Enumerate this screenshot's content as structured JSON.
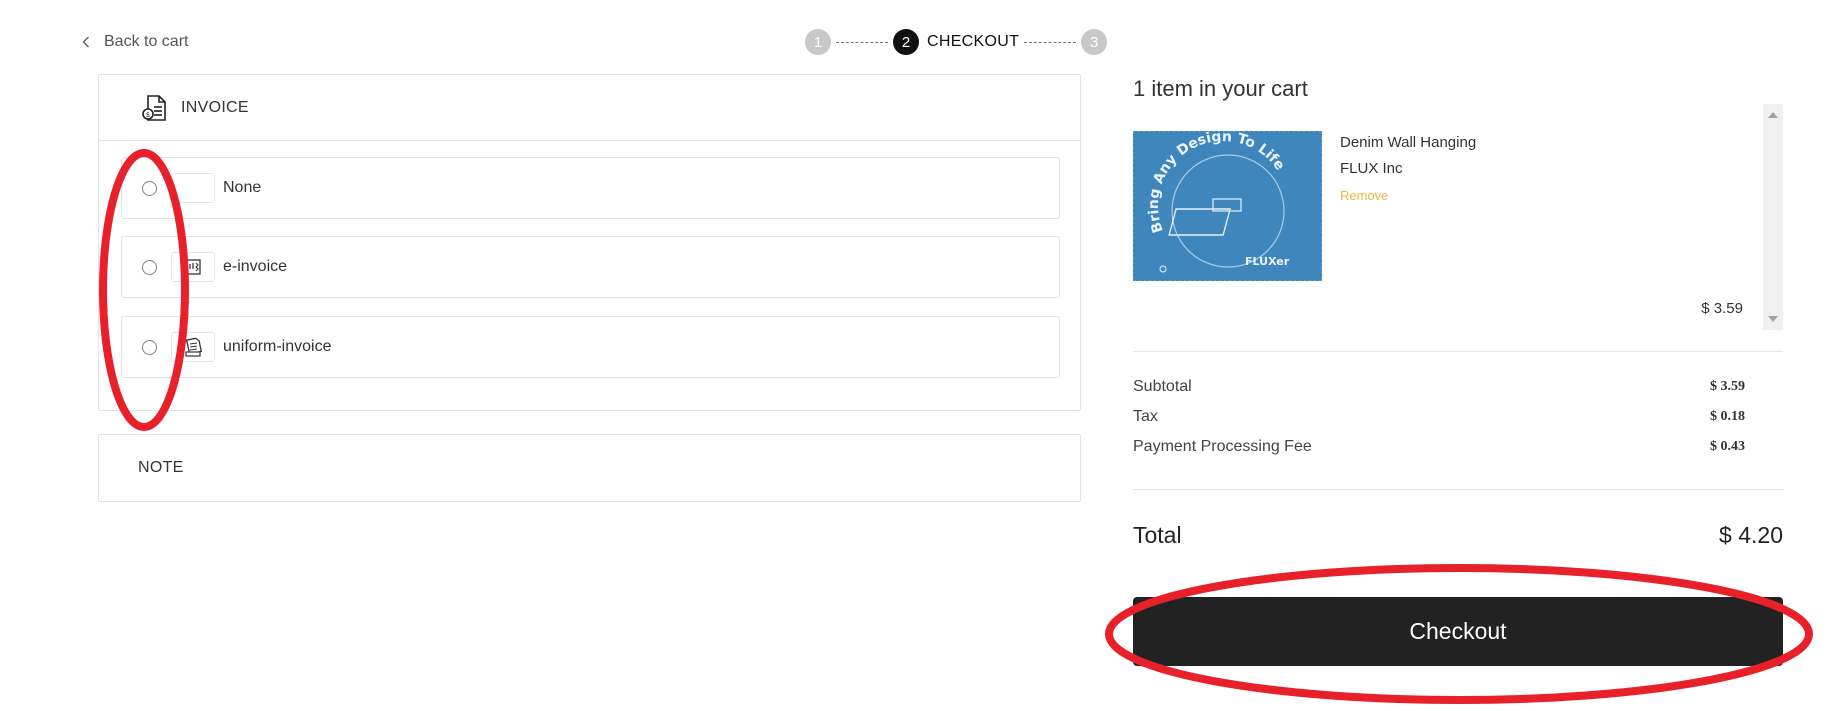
{
  "nav": {
    "back_label": "Back to cart"
  },
  "stepper": {
    "steps": [
      {
        "number": "1"
      },
      {
        "number": "2",
        "label": "CHECKOUT"
      },
      {
        "number": "3"
      }
    ]
  },
  "invoice": {
    "title": "INVOICE",
    "options": [
      {
        "label": "None",
        "icon": "blank-icon"
      },
      {
        "label": "e-invoice",
        "icon": "receipt-icon"
      },
      {
        "label": "uniform-invoice",
        "icon": "invoice-paper-icon"
      }
    ]
  },
  "note": {
    "title": "NOTE"
  },
  "cart": {
    "title": "1 item in your cart",
    "item": {
      "name": "Denim Wall Hanging",
      "vendor": "FLUX Inc",
      "remove_label": "Remove",
      "price": "$ 3.59",
      "image_text": "Bring Any Design To Life",
      "image_brand": "FLUXer"
    },
    "summary": [
      {
        "label": "Subtotal",
        "value": "$ 3.59"
      },
      {
        "label": "Tax",
        "value": "$ 0.18"
      },
      {
        "label": "Payment Processing Fee",
        "value": "$ 0.43"
      }
    ],
    "total_label": "Total",
    "total_value": "$ 4.20",
    "checkout_label": "Checkout"
  },
  "colors": {
    "accent_remove": "#f2b441",
    "checkout_bg": "#222222",
    "annotation_red": "#e8202a",
    "denim_blue": "#3f86bd"
  }
}
